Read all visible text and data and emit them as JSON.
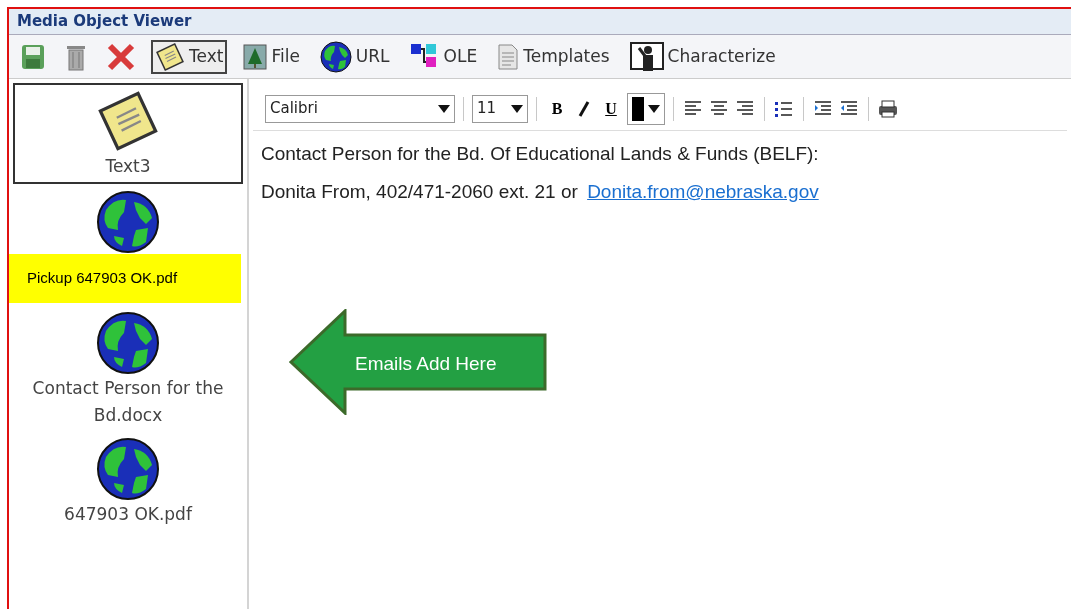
{
  "window": {
    "title": "Media Object Viewer"
  },
  "toolbar": [
    {
      "kind": "save"
    },
    {
      "kind": "delete"
    },
    {
      "kind": "close"
    },
    {
      "kind": "text",
      "label": "Text",
      "selected": true
    },
    {
      "kind": "file",
      "label": "File",
      "selected": false
    },
    {
      "kind": "url",
      "label": "URL",
      "selected": false
    },
    {
      "kind": "ole",
      "label": "OLE",
      "selected": false
    },
    {
      "kind": "templates",
      "label": "Templates",
      "selected": false
    },
    {
      "kind": "characterize",
      "label": "Characterize",
      "selected": false
    }
  ],
  "objects": [
    {
      "kind": "text",
      "label": "Text3",
      "selected": true
    },
    {
      "kind": "url",
      "note": "Pickup 647903 OK.pdf",
      "selected": false
    },
    {
      "kind": "url",
      "label": "Contact Person for the Bd.docx",
      "selected": false
    },
    {
      "kind": "url",
      "label": "647903 OK.pdf",
      "selected": false
    }
  ],
  "editor": {
    "font": "Calibri",
    "size": "11",
    "bold": "B",
    "underline": "U",
    "lines": [
      {
        "text": "Contact Person for the Bd. Of Educational Lands & Funds (BELF):"
      },
      {
        "text": "Donita From, 402/471-2060 ext. 21 or",
        "link": "Donita.from@nebraska.gov"
      }
    ]
  },
  "callout": {
    "text": "Emails Add Here"
  }
}
